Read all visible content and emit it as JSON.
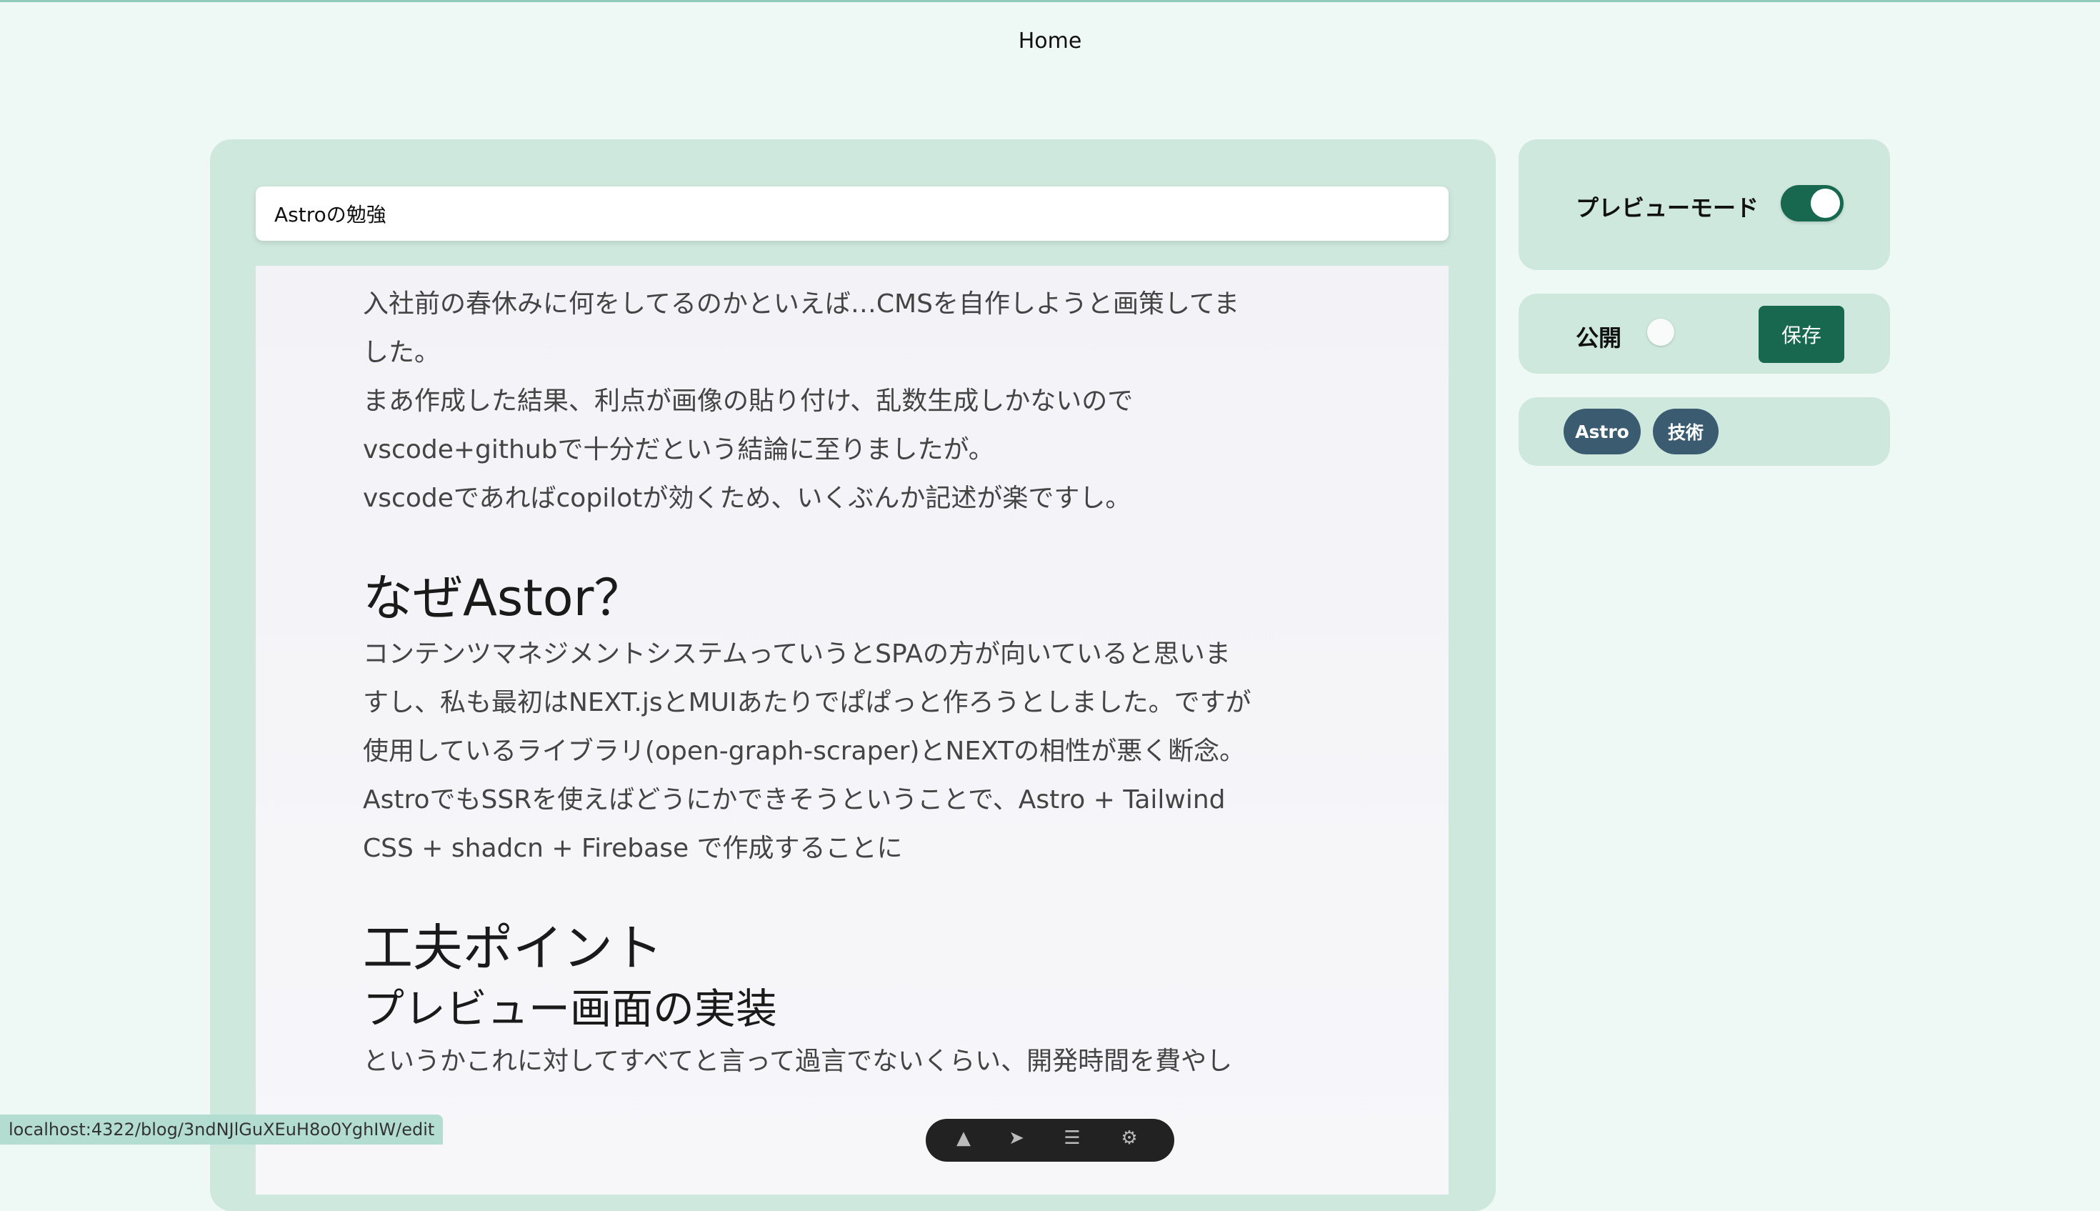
{
  "nav": {
    "home": "Home"
  },
  "editor": {
    "title_value": "Astroの勉強",
    "content": {
      "p1": [
        "入社前の春休みに何をしてるのかといえば…CMSを自作しようと画策してま",
        "した。",
        "まあ作成した結果、利点が画像の貼り付け、乱数生成しかないので",
        "vscode+githubで十分だという結論に至りましたが。",
        "vscodeであればcopilotが効くため、いくぶんか記述が楽ですし。"
      ],
      "h1_why": "なぜAstor？",
      "p2": [
        "コンテンツマネジメントシステムっていうとSPAの方が向いていると思いま",
        "すし、私も最初はNEXT.jsとMUIあたりでぱぱっと作ろうとしました。ですが",
        "使用しているライブラリ(open-graph-scraper)とNEXTの相性が悪く断念。",
        "AstroでもSSRを使えばどうにかできそうということで、Astro + Tailwind",
        "CSS + shadcn + Firebase で作成することに"
      ],
      "h1_points": "工夫ポイント",
      "h2_preview": "プレビュー画面の実装",
      "p3": "というかこれに対してすべてと言って過言でないくらい、開発時間を費やし"
    }
  },
  "sidebar": {
    "preview_mode_label": "プレビューモード",
    "preview_mode_on": true,
    "publish_label": "公開",
    "publish_on": false,
    "save_label": "保存",
    "tags": [
      "Astro",
      "技術"
    ]
  },
  "status_url": "localhost:4322/blog/3ndNJlGuXEuH8o0YghIW/edit",
  "colors": {
    "accent": "#17684f",
    "card": "#cfe8de",
    "background": "#eef8f4",
    "tag": "#3b5b70"
  }
}
